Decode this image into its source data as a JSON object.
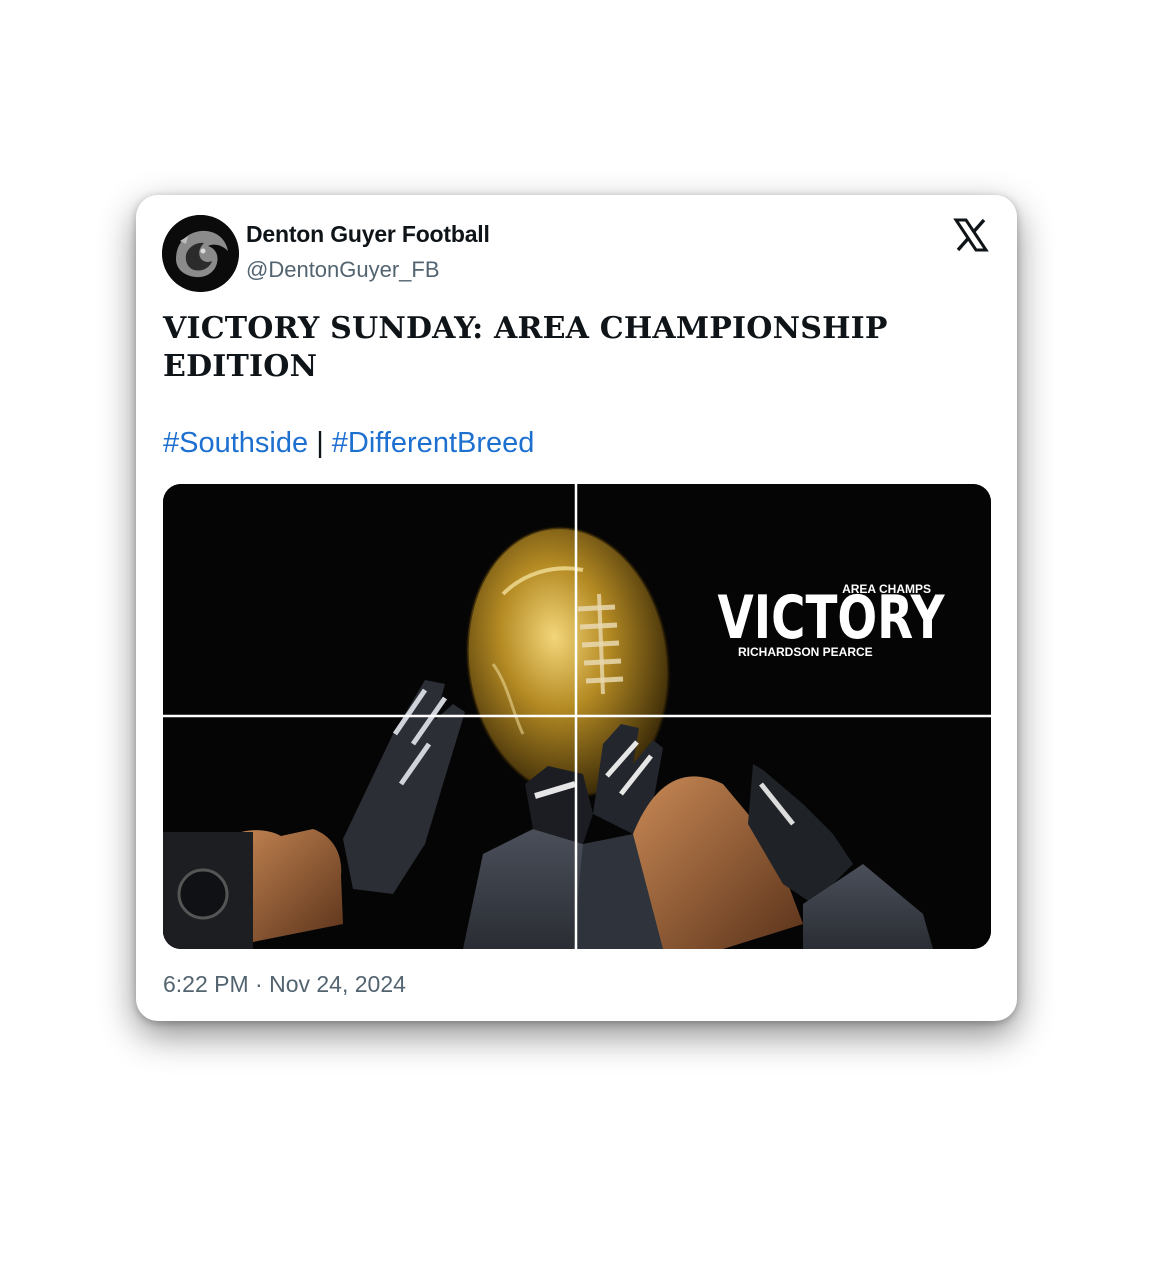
{
  "author": {
    "name": "Denton Guyer Football",
    "handle": "@DentonGuyer_FB"
  },
  "post": {
    "headline": "VICTORY SUNDAY: AREA CHAMPIONSHIP EDITION",
    "hashtags": [
      "#Southside",
      "#DifferentBreed"
    ],
    "separator": "|",
    "timestamp": "6:22 PM · Nov 24, 2024"
  },
  "media": {
    "small_top": "AREA CHAMPS",
    "big_word": "VICTORY",
    "small_bottom": "RICHARDSON PEARCE"
  },
  "icons": {
    "platform": "x-logo-icon"
  },
  "colors": {
    "hashtag": "#1d6fd0",
    "text": "#0f1419",
    "muted": "#536471",
    "media_bg": "#050505",
    "trophy_gold": "#c9a227"
  }
}
